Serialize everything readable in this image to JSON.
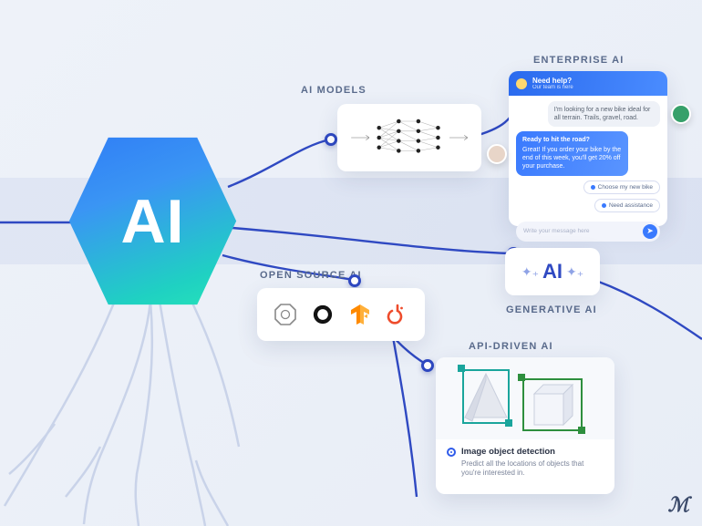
{
  "main": {
    "hexLabel": "AI"
  },
  "colors": {
    "accent": "#2f49c2",
    "gradientA": "#2f7cf6",
    "gradientB": "#28e6b7"
  },
  "sections": {
    "models": {
      "title": "AI MODELS"
    },
    "enterprise": {
      "title": "ENTERPRISE AI"
    },
    "opensource": {
      "title": "OPEN SOURCE AI"
    },
    "generative": {
      "title": "GENERATIVE AI",
      "label": "AI"
    },
    "api": {
      "title": "API-DRIVEN AI"
    }
  },
  "opensource_icons": [
    "octagon-icon",
    "knot-icon",
    "tensorflow-icon",
    "pytorch-icon"
  ],
  "chat": {
    "headerTitle": "Need help?",
    "headerSubtitle": "Our team is here",
    "messages": {
      "user1": "I'm looking for a new bike ideal for all terrain. Trails, gravel, road.",
      "botTitle": "Ready to hit the road?",
      "botBody": "Great! If you order your bike by the end of this week, you'll get 20% off your purchase.",
      "chip1": "Choose my new bike",
      "chip2": "Need assistance"
    },
    "inputPlaceholder": "Write your message here"
  },
  "api": {
    "radioLabel": "Image object detection",
    "description": "Predict all the locations of objects that you're interested in."
  }
}
